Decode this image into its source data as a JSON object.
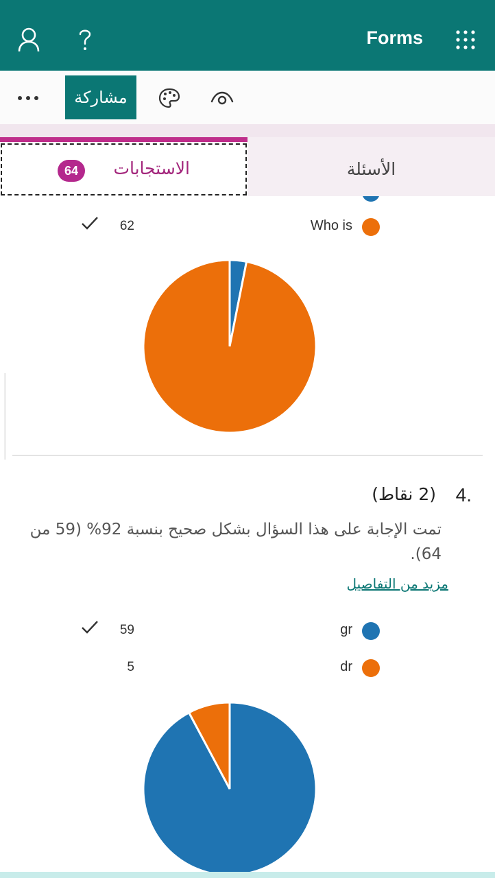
{
  "app": {
    "title": "Forms"
  },
  "toolbar": {
    "share_label": "مشاركة"
  },
  "tabs": {
    "responses_label": "الاستجابات",
    "responses_count": "64",
    "questions_label": "الأسئلة"
  },
  "question3": {
    "options": [
      {
        "label": "Who is",
        "count": "62",
        "correct": true,
        "color": "#ec6f0a"
      }
    ]
  },
  "question4": {
    "number": "4.",
    "points": "(2 نقاط)",
    "description": "تمت الإجابة على هذا السؤال بشكل صحيح بنسبة 92% (59 من 64).",
    "more_details": "مزيد من التفاصيل",
    "options": [
      {
        "label": "gr",
        "count": "59",
        "correct": true,
        "color": "#1f74b2"
      },
      {
        "label": "dr",
        "count": "5",
        "correct": false,
        "color": "#ec6f0a"
      }
    ]
  },
  "colors": {
    "brand": "#0b7774",
    "accent_tab": "#bf2d8b",
    "blue": "#1f74b2",
    "orange": "#ec6f0a"
  },
  "chart_data": [
    {
      "type": "pie",
      "categories": [
        "(partially hidden option)",
        "Who is"
      ],
      "values": [
        2,
        62
      ],
      "colors": [
        "#1f74b2",
        "#ec6f0a"
      ]
    },
    {
      "type": "pie",
      "categories": [
        "gr",
        "dr"
      ],
      "values": [
        59,
        5
      ],
      "colors": [
        "#1f74b2",
        "#ec6f0a"
      ]
    }
  ]
}
